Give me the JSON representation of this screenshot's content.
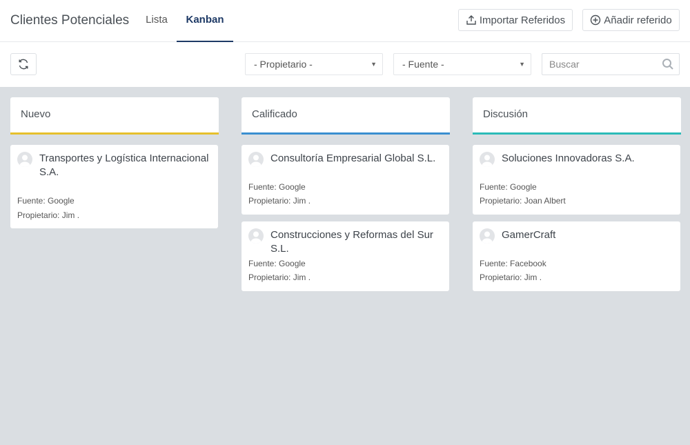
{
  "header": {
    "title": "Clientes Potenciales",
    "tabs": [
      {
        "label": "Lista",
        "active": false
      },
      {
        "label": "Kanban",
        "active": true
      }
    ],
    "import_label": "Importar Referidos",
    "add_label": "Añadir referido"
  },
  "toolbar": {
    "owner_select": "- Propietario -",
    "source_select": "- Fuente -",
    "search_placeholder": "Buscar"
  },
  "colors": {
    "nuevo": "#e6c02c",
    "calificado": "#3a8fd0",
    "discusion": "#2bbbb8",
    "active_tab": "#1e3a66",
    "board_bg": "#dadee2"
  },
  "columns": [
    {
      "title": "Nuevo",
      "cards": [
        {
          "title": "Transportes y Logística Internacional S.A.",
          "source": "Fuente: Google",
          "owner": "Propietario: Jim ."
        }
      ]
    },
    {
      "title": "Calificado",
      "cards": [
        {
          "title": "Consultoría Empresarial Global S.L.",
          "source": "Fuente: Google",
          "owner": "Propietario: Jim ."
        },
        {
          "title": "Construcciones y Reformas del Sur S.L.",
          "source": "Fuente: Google",
          "owner": "Propietario: Jim ."
        }
      ]
    },
    {
      "title": "Discusión",
      "cards": [
        {
          "title": "Soluciones Innovadoras S.A.",
          "source": "Fuente: Google",
          "owner": "Propietario: Joan Albert"
        },
        {
          "title": "GamerCraft",
          "source": "Fuente: Facebook",
          "owner": "Propietario: Jim ."
        }
      ]
    }
  ]
}
